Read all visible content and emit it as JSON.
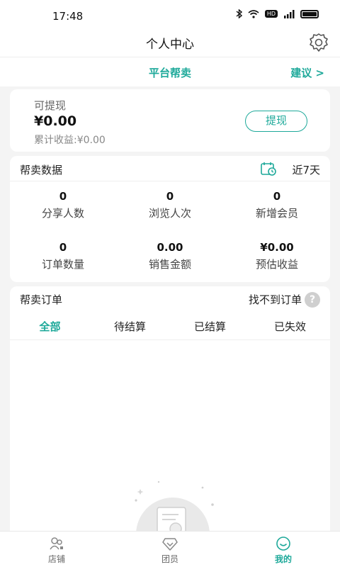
{
  "status_bar": {
    "time": "17:48",
    "network_badge": "HD"
  },
  "header": {
    "title": "个人中心",
    "settings_icon": "gear-icon"
  },
  "nav": {
    "title": "平台帮卖",
    "suggest": "建议 >"
  },
  "withdraw": {
    "label": "可提现",
    "amount": "¥0.00",
    "total_earnings": "累计收益:¥0.00",
    "button": "提现"
  },
  "stats": {
    "title": "帮卖数据",
    "range": "近7天",
    "items": [
      {
        "value": "0",
        "label": "分享人数"
      },
      {
        "value": "0",
        "label": "浏览人次"
      },
      {
        "value": "0",
        "label": "新增会员"
      },
      {
        "value": "0",
        "label": "订单数量"
      },
      {
        "value": "0.00",
        "label": "销售金额"
      },
      {
        "value": "¥0.00",
        "label": "预估收益"
      }
    ]
  },
  "orders": {
    "title": "帮卖订单",
    "not_found": "找不到订单",
    "help_glyph": "?",
    "tabs": [
      "全部",
      "待结算",
      "已结算",
      "已失效"
    ],
    "active_tab": 0
  },
  "tabbar": {
    "items": [
      {
        "label": "店铺",
        "icon": "store-icon"
      },
      {
        "label": "团员",
        "icon": "diamond-icon"
      },
      {
        "label": "我的",
        "icon": "smiley-icon"
      }
    ],
    "active": 2
  },
  "colors": {
    "accent": "#1ea99a",
    "background": "#f4f4f4"
  }
}
